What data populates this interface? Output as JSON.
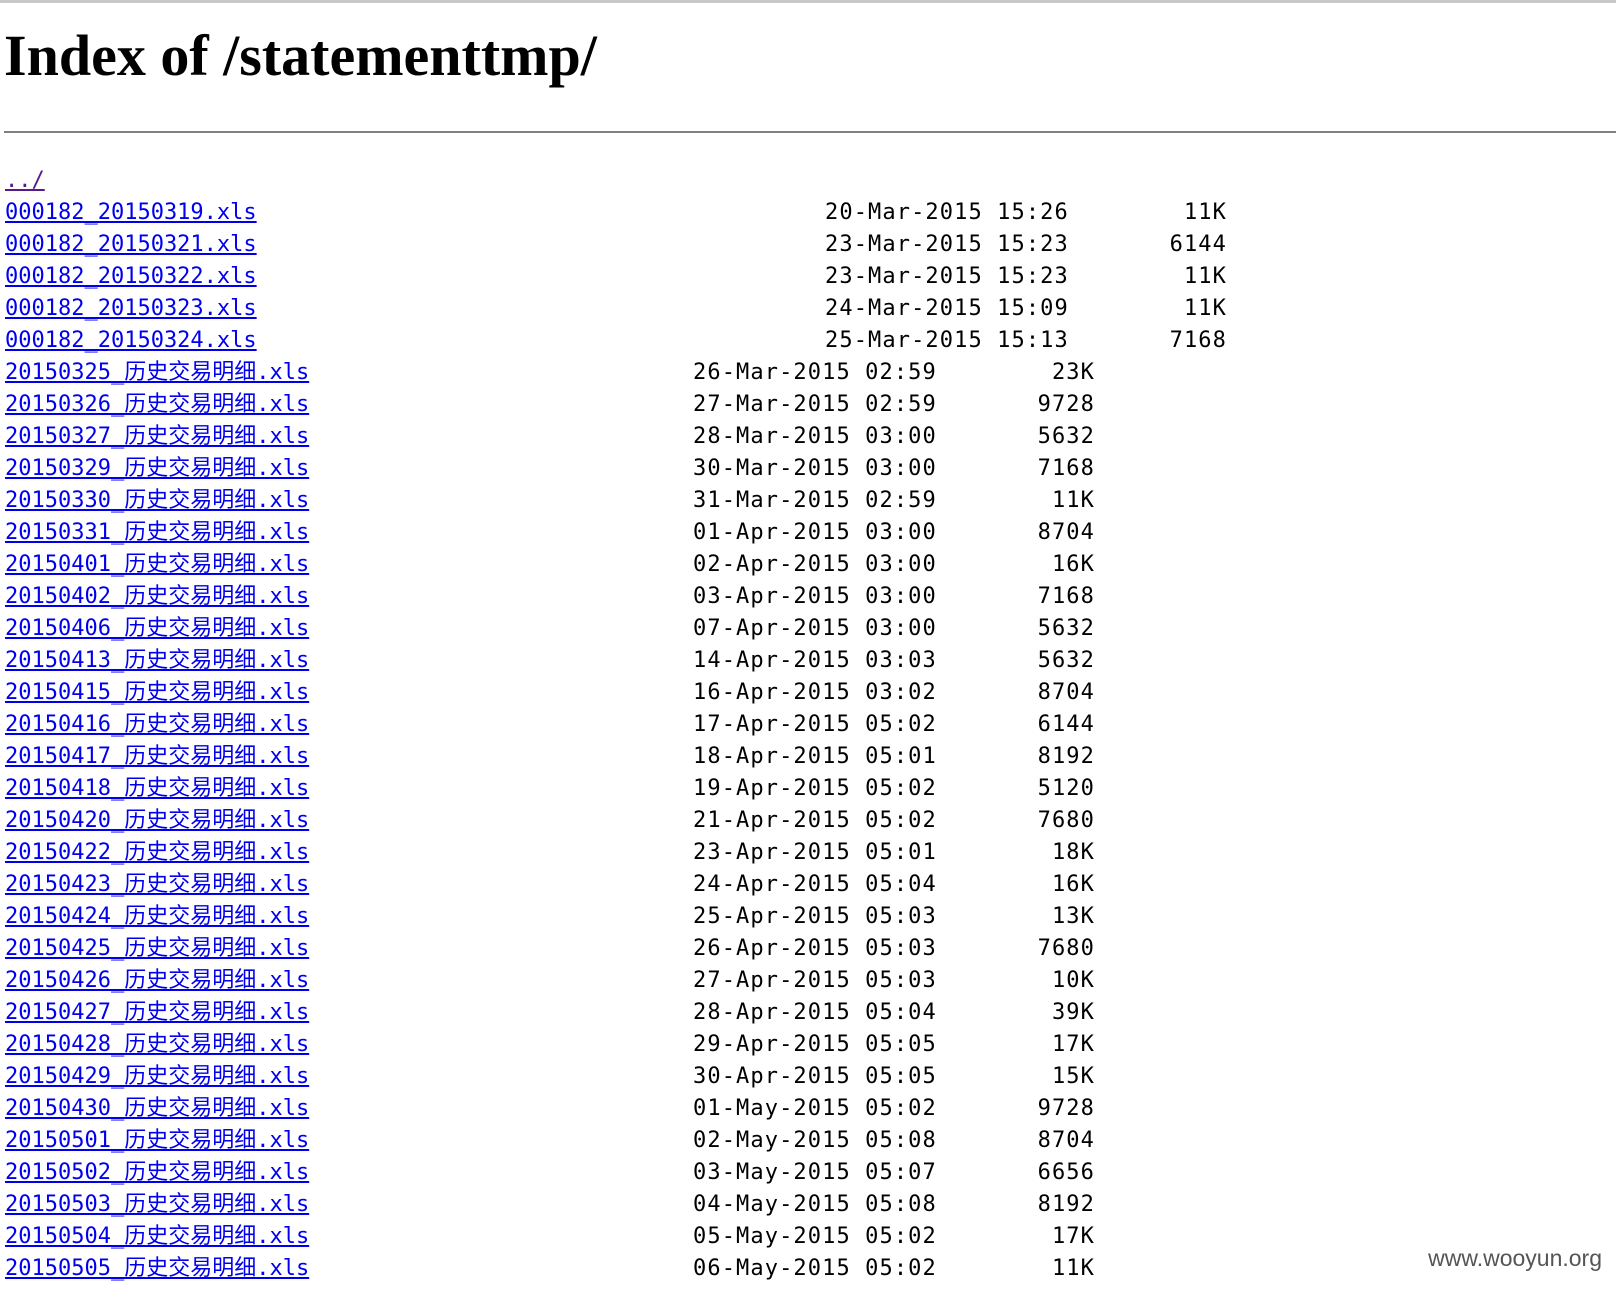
{
  "title": "Index of /statementtmp/",
  "parent_link": "../",
  "files_short": [
    {
      "name": "000182_20150319.xls",
      "date": "20-Mar-2015 15:26",
      "size": "11K"
    },
    {
      "name": "000182_20150321.xls",
      "date": "23-Mar-2015 15:23",
      "size": "6144"
    },
    {
      "name": "000182_20150322.xls",
      "date": "23-Mar-2015 15:23",
      "size": "11K"
    },
    {
      "name": "000182_20150323.xls",
      "date": "24-Mar-2015 15:09",
      "size": "11K"
    },
    {
      "name": "000182_20150324.xls",
      "date": "25-Mar-2015 15:13",
      "size": "7168"
    }
  ],
  "files_long": [
    {
      "name": "20150325_历史交易明细.xls",
      "date": "26-Mar-2015 02:59",
      "size": "23K"
    },
    {
      "name": "20150326_历史交易明细.xls",
      "date": "27-Mar-2015 02:59",
      "size": "9728"
    },
    {
      "name": "20150327_历史交易明细.xls",
      "date": "28-Mar-2015 03:00",
      "size": "5632"
    },
    {
      "name": "20150329_历史交易明细.xls",
      "date": "30-Mar-2015 03:00",
      "size": "7168"
    },
    {
      "name": "20150330_历史交易明细.xls",
      "date": "31-Mar-2015 02:59",
      "size": "11K"
    },
    {
      "name": "20150331_历史交易明细.xls",
      "date": "01-Apr-2015 03:00",
      "size": "8704"
    },
    {
      "name": "20150401_历史交易明细.xls",
      "date": "02-Apr-2015 03:00",
      "size": "16K"
    },
    {
      "name": "20150402_历史交易明细.xls",
      "date": "03-Apr-2015 03:00",
      "size": "7168"
    },
    {
      "name": "20150406_历史交易明细.xls",
      "date": "07-Apr-2015 03:00",
      "size": "5632"
    },
    {
      "name": "20150413_历史交易明细.xls",
      "date": "14-Apr-2015 03:03",
      "size": "5632"
    },
    {
      "name": "20150415_历史交易明细.xls",
      "date": "16-Apr-2015 03:02",
      "size": "8704"
    },
    {
      "name": "20150416_历史交易明细.xls",
      "date": "17-Apr-2015 05:02",
      "size": "6144"
    },
    {
      "name": "20150417_历史交易明细.xls",
      "date": "18-Apr-2015 05:01",
      "size": "8192"
    },
    {
      "name": "20150418_历史交易明细.xls",
      "date": "19-Apr-2015 05:02",
      "size": "5120"
    },
    {
      "name": "20150420_历史交易明细.xls",
      "date": "21-Apr-2015 05:02",
      "size": "7680"
    },
    {
      "name": "20150422_历史交易明细.xls",
      "date": "23-Apr-2015 05:01",
      "size": "18K"
    },
    {
      "name": "20150423_历史交易明细.xls",
      "date": "24-Apr-2015 05:04",
      "size": "16K"
    },
    {
      "name": "20150424_历史交易明细.xls",
      "date": "25-Apr-2015 05:03",
      "size": "13K"
    },
    {
      "name": "20150425_历史交易明细.xls",
      "date": "26-Apr-2015 05:03",
      "size": "7680"
    },
    {
      "name": "20150426_历史交易明细.xls",
      "date": "27-Apr-2015 05:03",
      "size": "10K"
    },
    {
      "name": "20150427_历史交易明细.xls",
      "date": "28-Apr-2015 05:04",
      "size": "39K"
    },
    {
      "name": "20150428_历史交易明细.xls",
      "date": "29-Apr-2015 05:05",
      "size": "17K"
    },
    {
      "name": "20150429_历史交易明细.xls",
      "date": "30-Apr-2015 05:05",
      "size": "15K"
    },
    {
      "name": "20150430_历史交易明细.xls",
      "date": "01-May-2015 05:02",
      "size": "9728"
    },
    {
      "name": "20150501_历史交易明细.xls",
      "date": "02-May-2015 05:08",
      "size": "8704"
    },
    {
      "name": "20150502_历史交易明细.xls",
      "date": "03-May-2015 05:07",
      "size": "6656"
    },
    {
      "name": "20150503_历史交易明细.xls",
      "date": "04-May-2015 05:08",
      "size": "8192"
    },
    {
      "name": "20150504_历史交易明细.xls",
      "date": "05-May-2015 05:02",
      "size": "17K"
    },
    {
      "name": "20150505_历史交易明细.xls",
      "date": "06-May-2015 05:02",
      "size": "11K"
    }
  ],
  "watermark": "www.wooyun.org",
  "colors": {
    "link": "#0000ee",
    "visited_link": "#551a8b",
    "text": "#000000",
    "rule": "#808080"
  }
}
